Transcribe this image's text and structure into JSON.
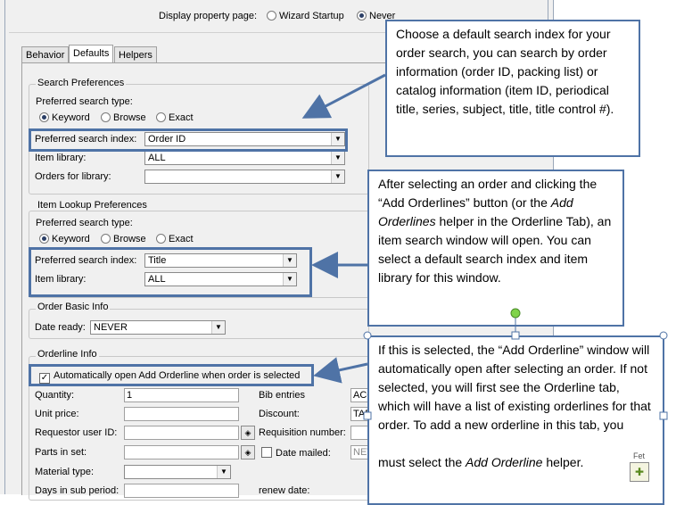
{
  "display_row": {
    "label": "Display property page:",
    "option_wizard": "Wizard Startup",
    "option_never": "Never"
  },
  "tabs": [
    "Behavior",
    "Defaults",
    "Helpers"
  ],
  "search_prefs": {
    "title": "Search Preferences",
    "type_label": "Preferred search type:",
    "radio_keyword": "Keyword",
    "radio_browse": "Browse",
    "radio_exact": "Exact",
    "index_label": "Preferred search index:",
    "index_value": "Order ID",
    "library_label": "Item library:",
    "library_value": "ALL",
    "orders_label": "Orders for library:",
    "orders_value": ""
  },
  "item_lookup": {
    "title": "Item Lookup Preferences",
    "type_label": "Preferred search type:",
    "radio_keyword": "Keyword",
    "radio_browse": "Browse",
    "radio_exact": "Exact",
    "index_label": "Preferred search index:",
    "index_value": "Title",
    "library_label": "Item library:",
    "library_value": "ALL"
  },
  "order_basic": {
    "title": "Order Basic Info",
    "date_label": "Date ready:",
    "date_value": "NEVER"
  },
  "orderline": {
    "title": "Orderline Info",
    "auto_open_label": "Automatically open Add Orderline when order is selected",
    "quantity_label": "Quantity:",
    "quantity_value": "1",
    "unit_price_label": "Unit price:",
    "requestor_label": "Requestor user ID:",
    "parts_label": "Parts in set:",
    "material_label": "Material type:",
    "days_label": "Days in sub period:",
    "bib_label": "Bib entries",
    "bib_value": "ACC",
    "discount_label": "Discount:",
    "discount_value": "TAB",
    "requisition_label": "Requisition number:",
    "date_mailed_label": "Date mailed:",
    "date_mailed_value": "NEV",
    "renew_label": "renew date:"
  },
  "callouts": {
    "search_index": "Choose a default search index for your order search, you can search by order information (order ID, packing list) or catalog information (item ID, periodical title, series, subject, title, title control #).",
    "item_lookup_p1": "After selecting an order and clicking the “Add Orderlines” button (or the ",
    "item_lookup_em": "Add Orderlines",
    "item_lookup_p2": " helper in the Orderline Tab), an item search window will open. You can select a default search index and item library for this window.",
    "auto_open_p1": "If this is selected, the “Add Orderline” window will automatically open after selecting an order. If not selected, you will first see the Orderline tab, which will have a list of existing orderlines for that order. To add a new orderline in this tab, you",
    "auto_open_p2": "must select the ",
    "auto_open_em": "Add Orderline",
    "auto_open_p3": " helper."
  },
  "corner_icon_label": "Fet",
  "colors": {
    "callout_border": "#4f73a6",
    "panel_bg": "#f0f0f0"
  }
}
